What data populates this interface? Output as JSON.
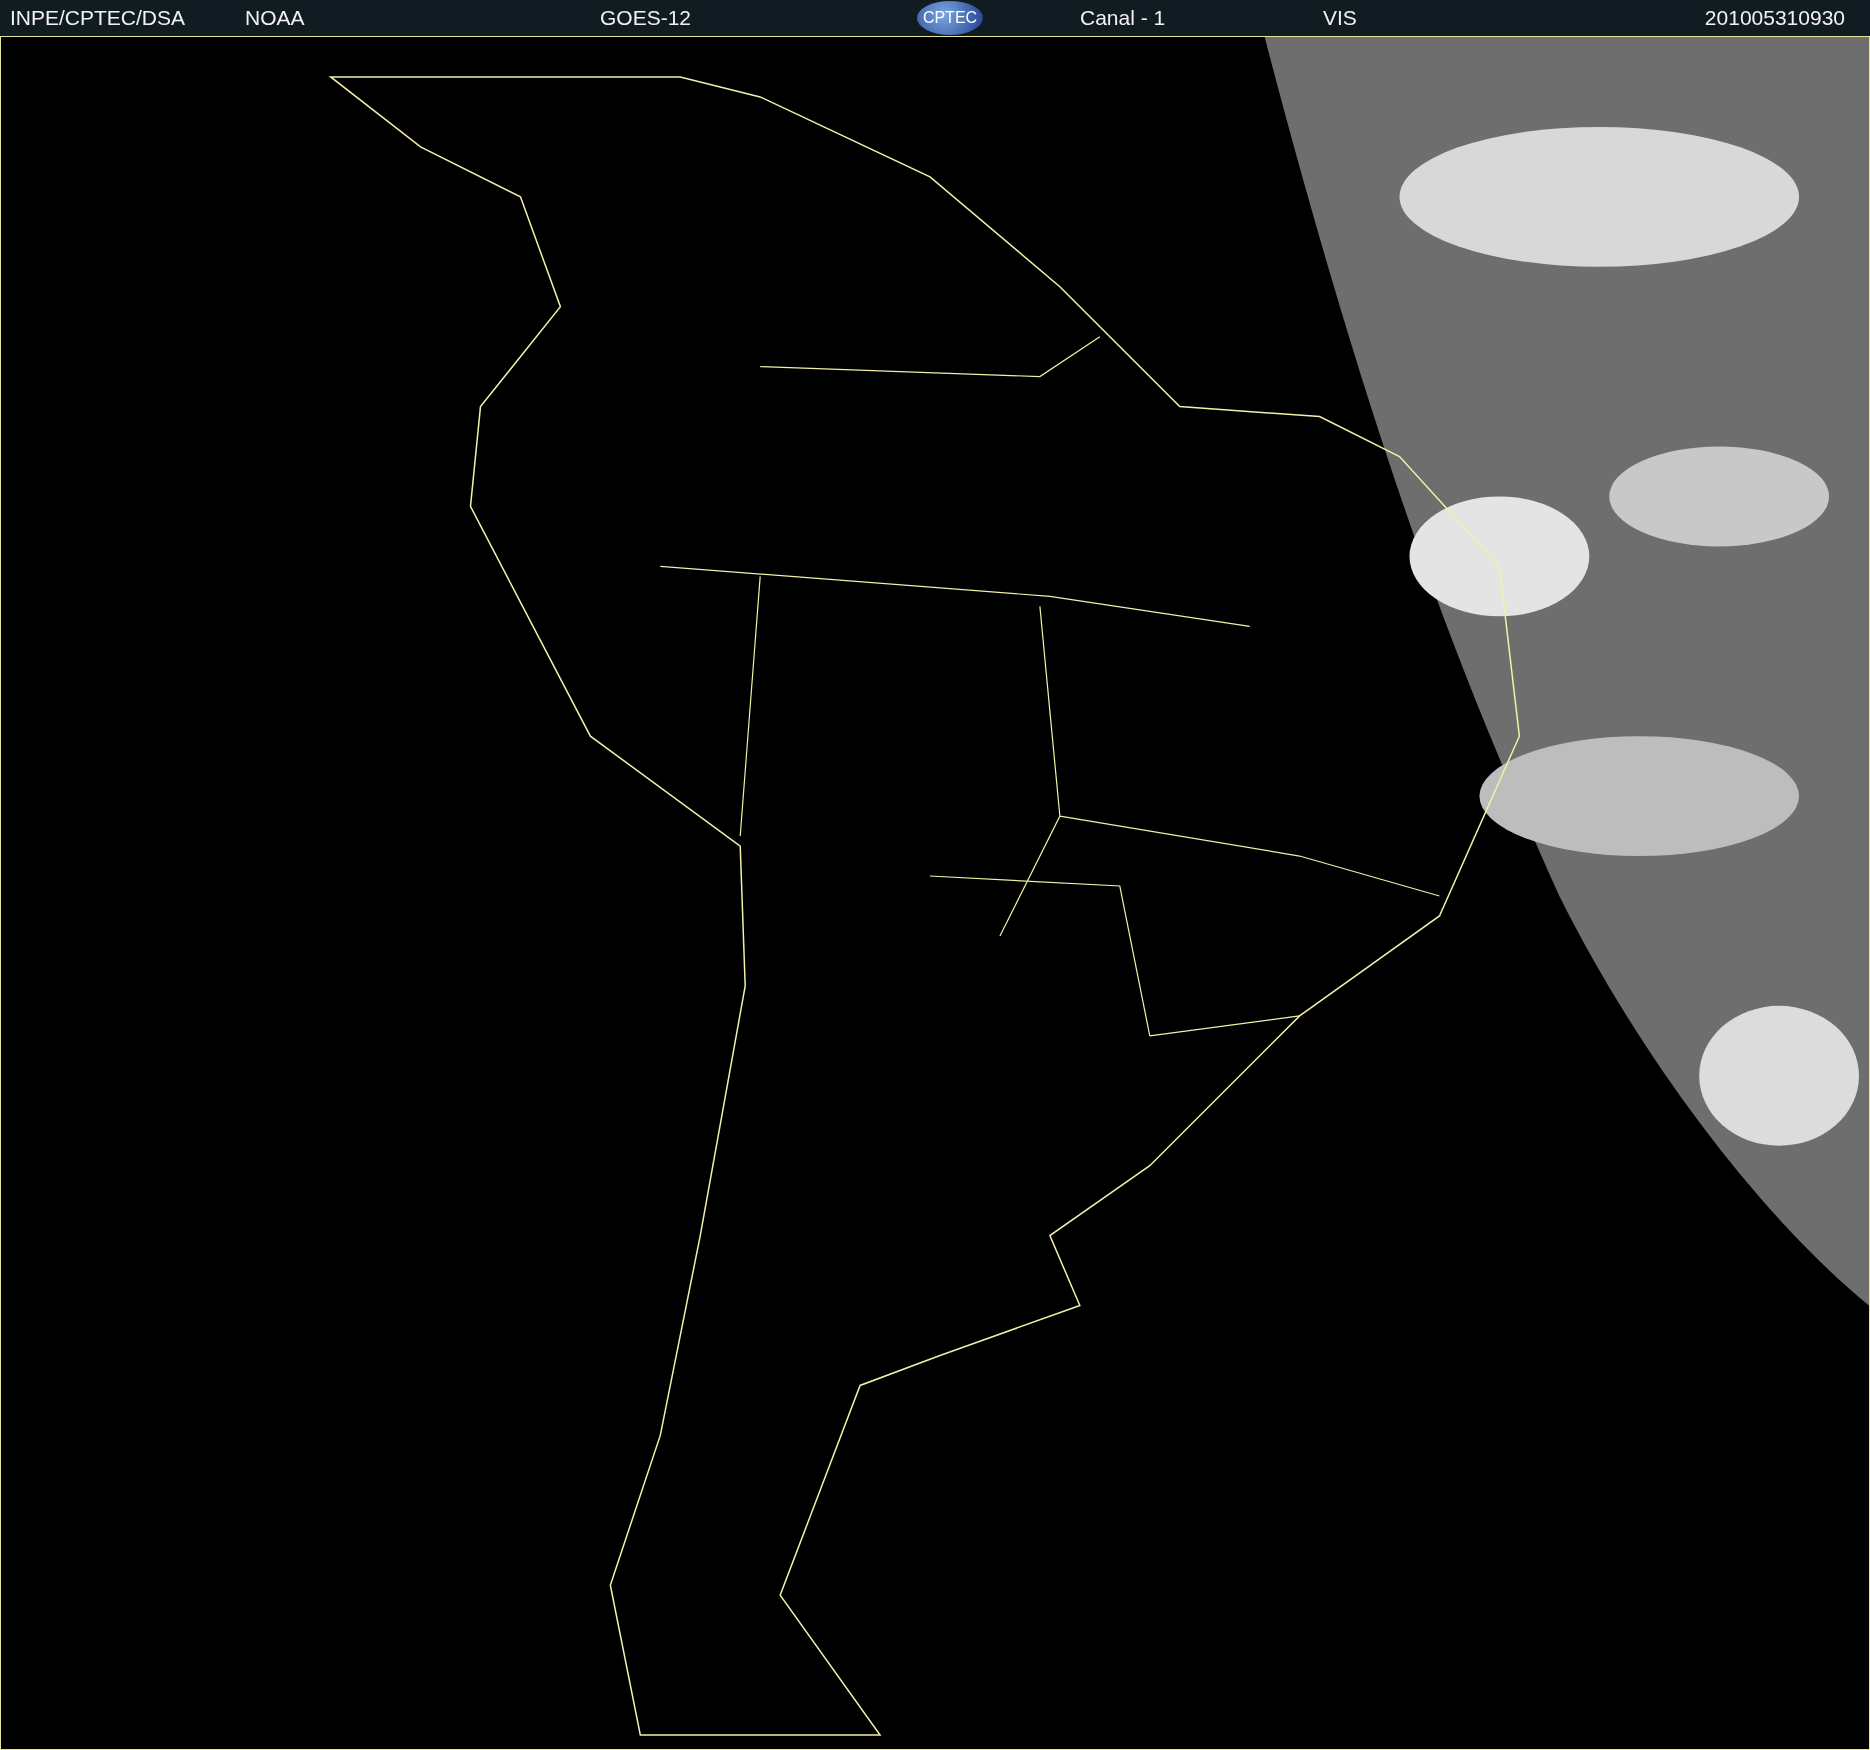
{
  "header": {
    "agency": "INPE/CPTEC/DSA",
    "source": "NOAA",
    "satellite": "GOES-12",
    "logo": "CPTEC",
    "channel": "Canal - 1",
    "band": "VIS",
    "timestamp": "201005310930"
  }
}
